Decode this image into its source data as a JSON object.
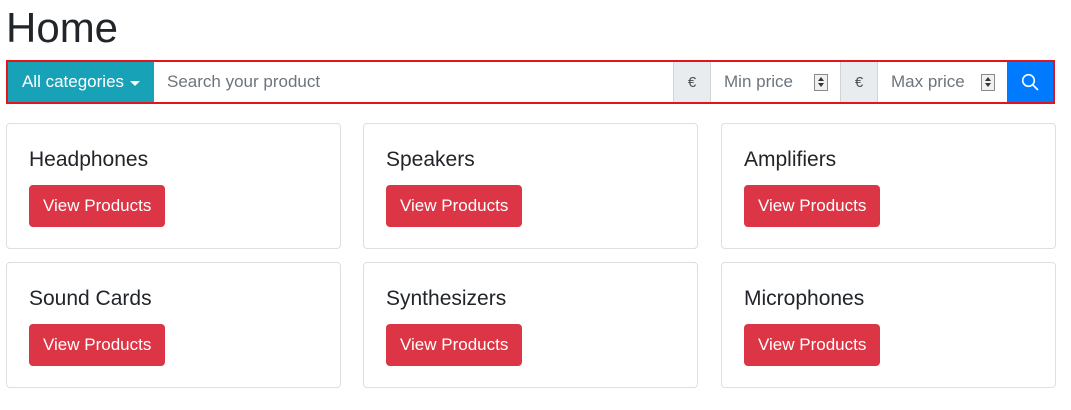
{
  "page": {
    "title": "Home"
  },
  "search": {
    "category_label": "All categories",
    "placeholder": "Search your product",
    "currency_symbol": "€",
    "min_placeholder": "Min price",
    "max_placeholder": "Max price"
  },
  "colors": {
    "category_button": "#17a2b8",
    "search_button": "#007bff",
    "view_button": "#dc3545",
    "search_bar_border": "#e0161b"
  },
  "categories": [
    {
      "title": "Headphones",
      "button_label": "View Products"
    },
    {
      "title": "Speakers",
      "button_label": "View Products"
    },
    {
      "title": "Amplifiers",
      "button_label": "View Products"
    },
    {
      "title": "Sound Cards",
      "button_label": "View Products"
    },
    {
      "title": "Synthesizers",
      "button_label": "View Products"
    },
    {
      "title": "Microphones",
      "button_label": "View Products"
    }
  ]
}
